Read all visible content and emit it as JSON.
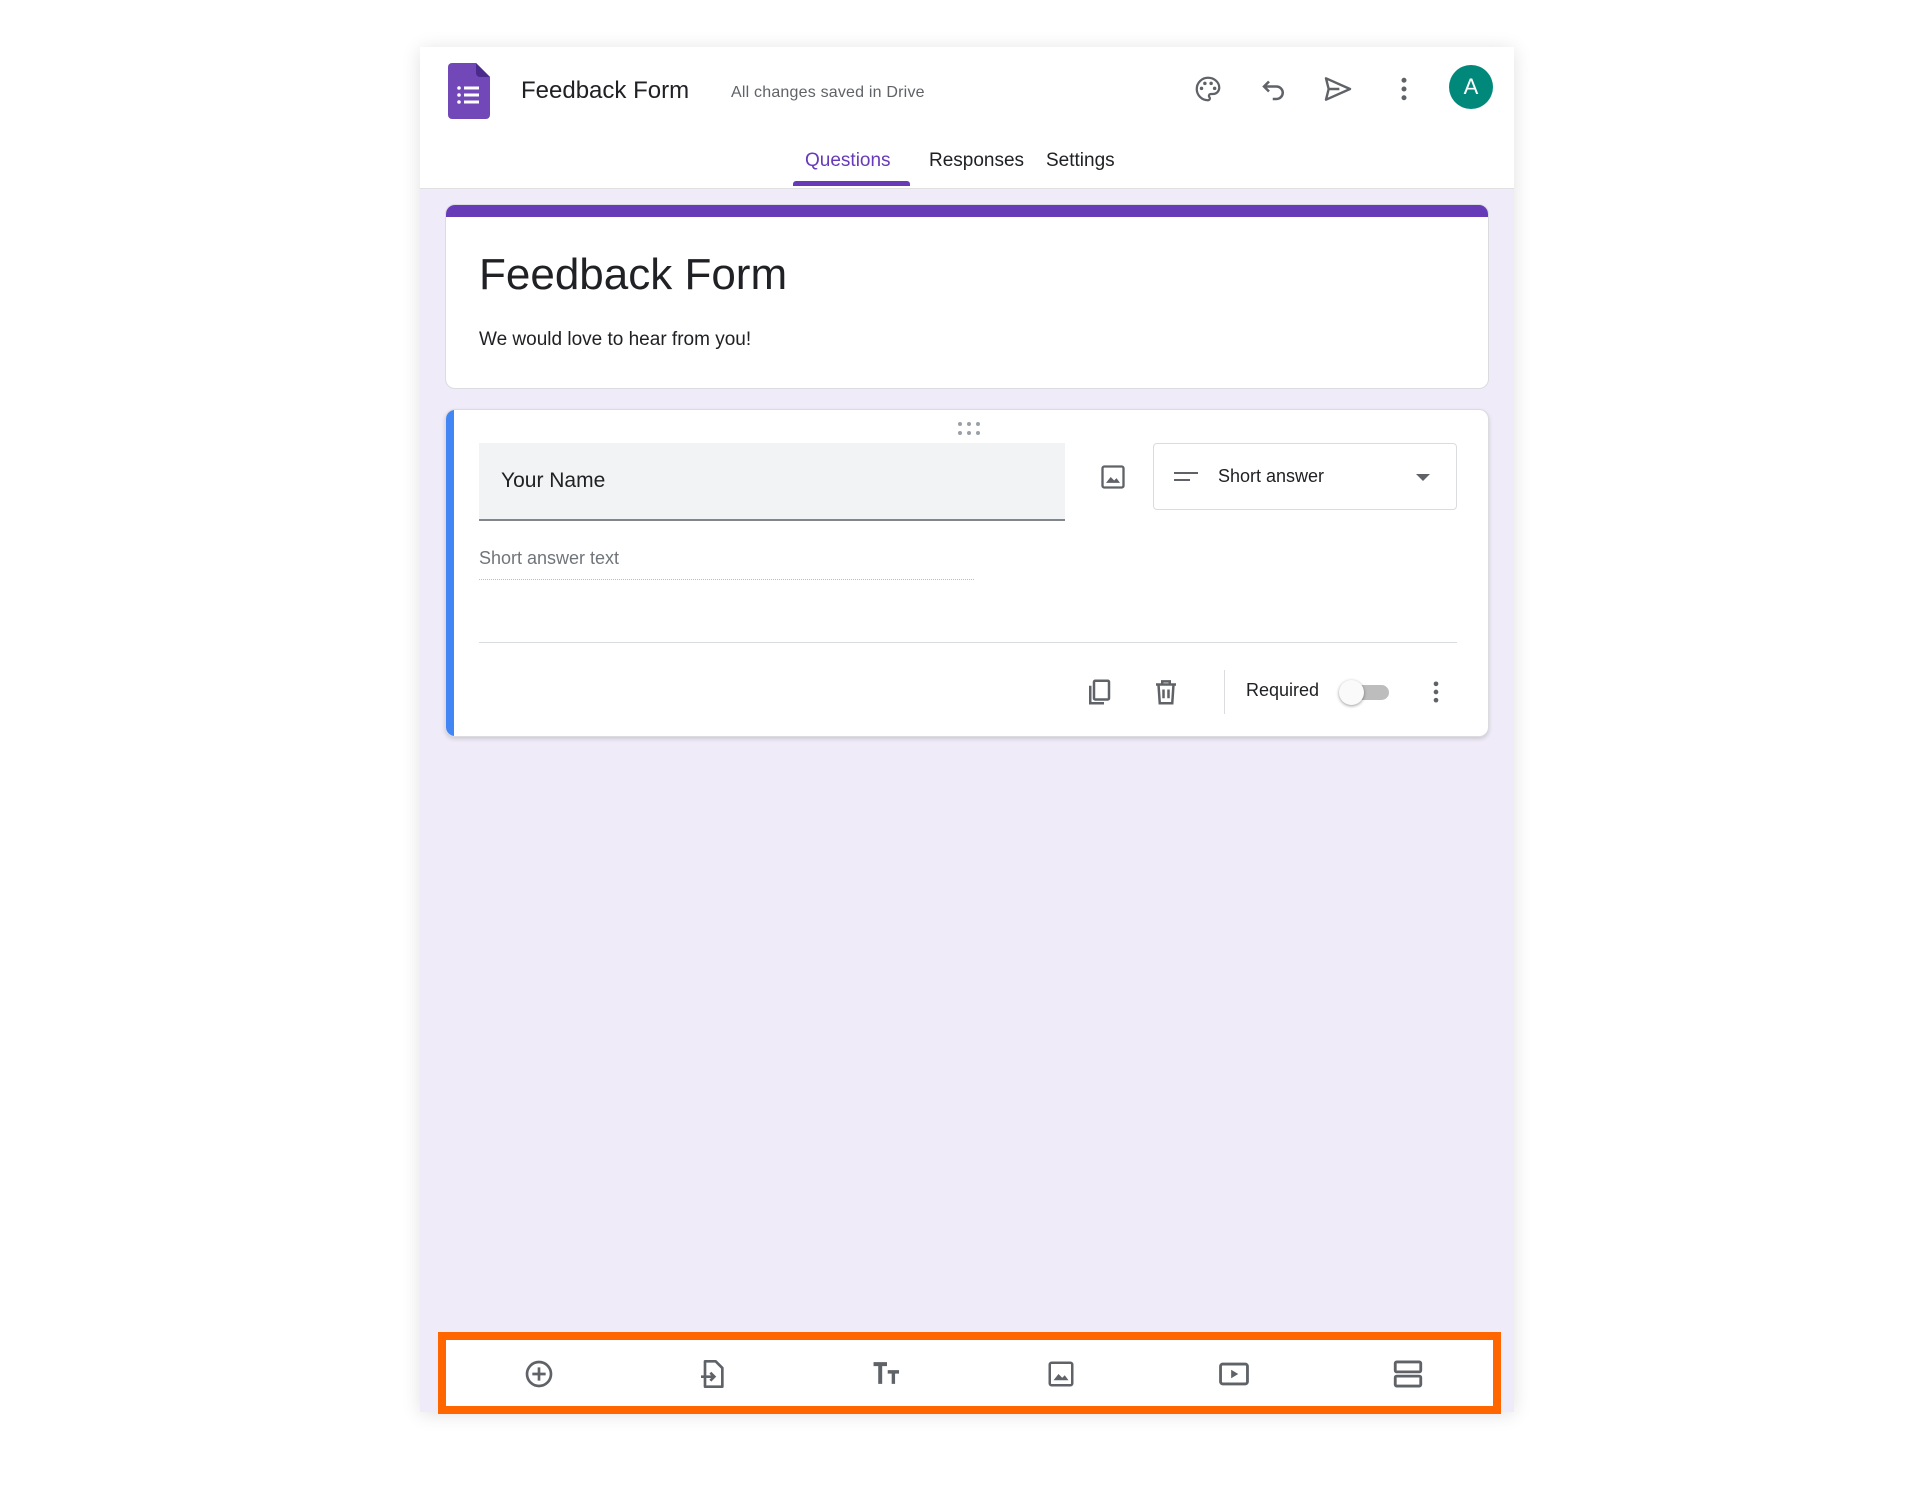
{
  "header": {
    "doc_title": "Feedback Form",
    "save_status": "All changes saved in Drive",
    "avatar_initial": "A",
    "icons": [
      "palette-icon",
      "undo-icon",
      "send-icon",
      "more-vert-icon"
    ]
  },
  "tabs": [
    {
      "label": "Questions",
      "active": true
    },
    {
      "label": "Responses",
      "active": false
    },
    {
      "label": "Settings",
      "active": false
    }
  ],
  "form": {
    "title": "Feedback Form",
    "description": "We would love to hear from you!"
  },
  "question": {
    "title": "Your Name",
    "type_label": "Short answer",
    "answer_placeholder": "Short answer text",
    "required_label": "Required",
    "required": false
  },
  "toolbar": {
    "buttons": [
      "add-question-icon",
      "import-questions-icon",
      "add-title-icon",
      "add-image-icon",
      "add-video-icon",
      "add-section-icon"
    ]
  },
  "colors": {
    "accent": "#673ab7",
    "question_accent": "#4285f4",
    "background": "#f0ebf8",
    "avatar": "#00897b",
    "highlight": "#ff6600"
  }
}
